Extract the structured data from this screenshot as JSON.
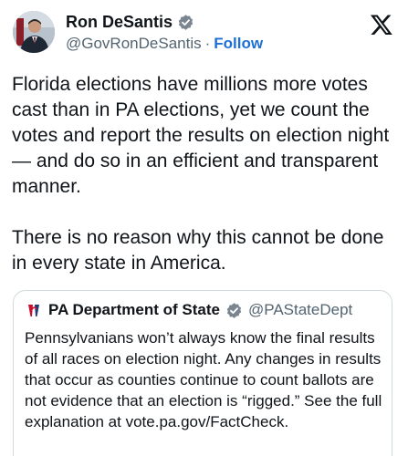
{
  "author": {
    "display_name": "Ron DeSantis",
    "handle": "@GovRonDeSantis",
    "separator": "·",
    "follow_label": "Follow",
    "verified": true
  },
  "tweet": {
    "paragraphs": [
      "Florida elections have millions more votes cast than in PA elections, yet we count the votes and report the results on election night — and do so in an efficient and transparent manner.",
      "There is no reason why this cannot be done in every state in America."
    ]
  },
  "quoted_tweet": {
    "display_name": "PA Department of State",
    "handle": "@PAStateDept",
    "verified": true,
    "text": "Pennsylvanians won’t always know the final results of all races on election night. Any changes in results that occur as counties continue to count ballots are not evidence that an election is “rigged.” See the full explanation at vote.pa.gov/FactCheck."
  },
  "icons": {
    "brand": "x-logo-icon",
    "verified": "verified-badge-icon",
    "quote_logo": "pa-keystone-logo-icon"
  },
  "colors": {
    "text": "#0f1419",
    "secondary_text": "#536471",
    "link": "#1d6fd6",
    "verified_badge": "#7b8590",
    "border": "#cfd9de"
  }
}
